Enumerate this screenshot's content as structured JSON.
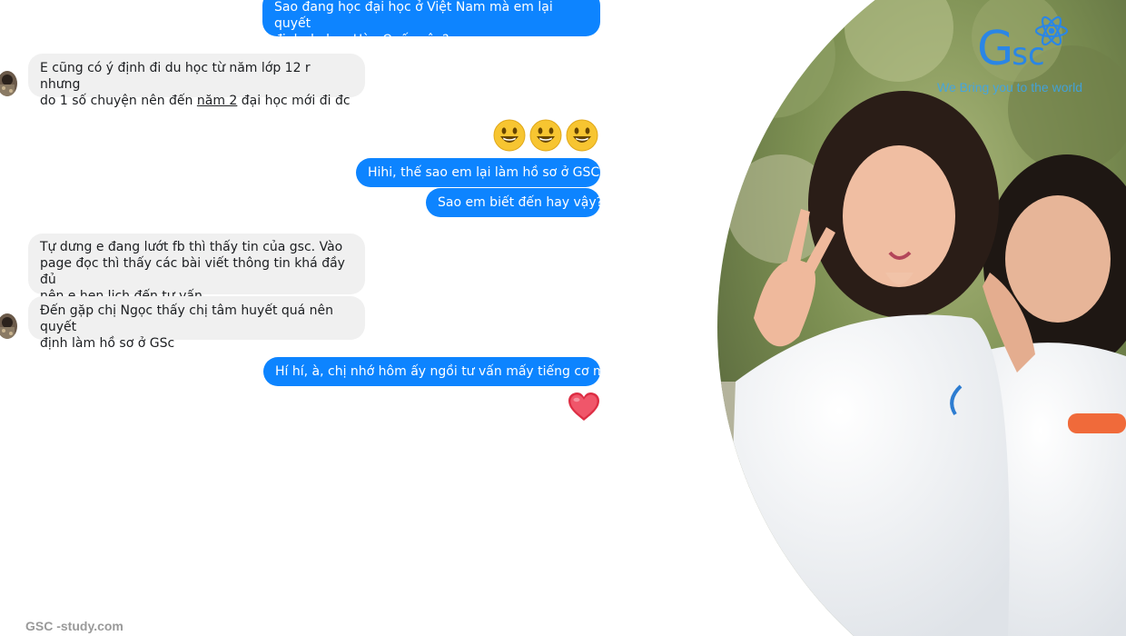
{
  "conversation": {
    "messages": [
      {
        "from": "me",
        "lines": [
          "Sao đang học đại học ở Việt Nam mà em lại quyết",
          "định du học Hàn Quốc vậy?"
        ]
      },
      {
        "from": "them",
        "lines": [
          "E cũng có ý định đi du học từ năm lớp 12 r nhưng"
        ],
        "line2_before": "do 1 số chuyện nên đến ",
        "line2_underlined": "năm 2",
        "line2_after": " đại học mới đi đc"
      },
      {
        "from": "me",
        "emoji": "smiley",
        "emoji_count": 3
      },
      {
        "from": "me",
        "text": "Hihi, thế sao em lại làm hồ sơ ở GSC?"
      },
      {
        "from": "me",
        "text": "Sao em biết đến hay vậy?"
      },
      {
        "from": "them",
        "lines": [
          "Tự dưng e đang lướt fb thì thấy tin của gsc. Vào",
          "page đọc thì thấy các bài viết thông tin khá đầy đủ",
          "nên e hẹn lịch đến tư vấn"
        ]
      },
      {
        "from": "them",
        "lines": [
          "Đến gặp chị Ngọc thấy chị tâm huyết quá nên quyết",
          "định làm hồ sơ ở GSc"
        ]
      },
      {
        "from": "me",
        "text": "Hí hí, à, chị nhớ hôm ấy ngồi tư vấn mấy tiếng cơ mà"
      },
      {
        "from": "me",
        "emoji": "heart"
      }
    ]
  },
  "brand": {
    "logo_letters_big": "G",
    "logo_letters_small": "sc",
    "tagline": "We Bring you to the world"
  },
  "footer": {
    "text": "GSC -study.com"
  },
  "colors": {
    "sent_bubble": "#0d84ff",
    "received_bubble": "#f0f0f0",
    "brand_blue": "#2a86e6"
  },
  "icons": {
    "avatar": "avatar-icon",
    "emoji": "smiley-emoji-icon",
    "heart": "heart-icon",
    "logo_mark": "atom-icon"
  }
}
